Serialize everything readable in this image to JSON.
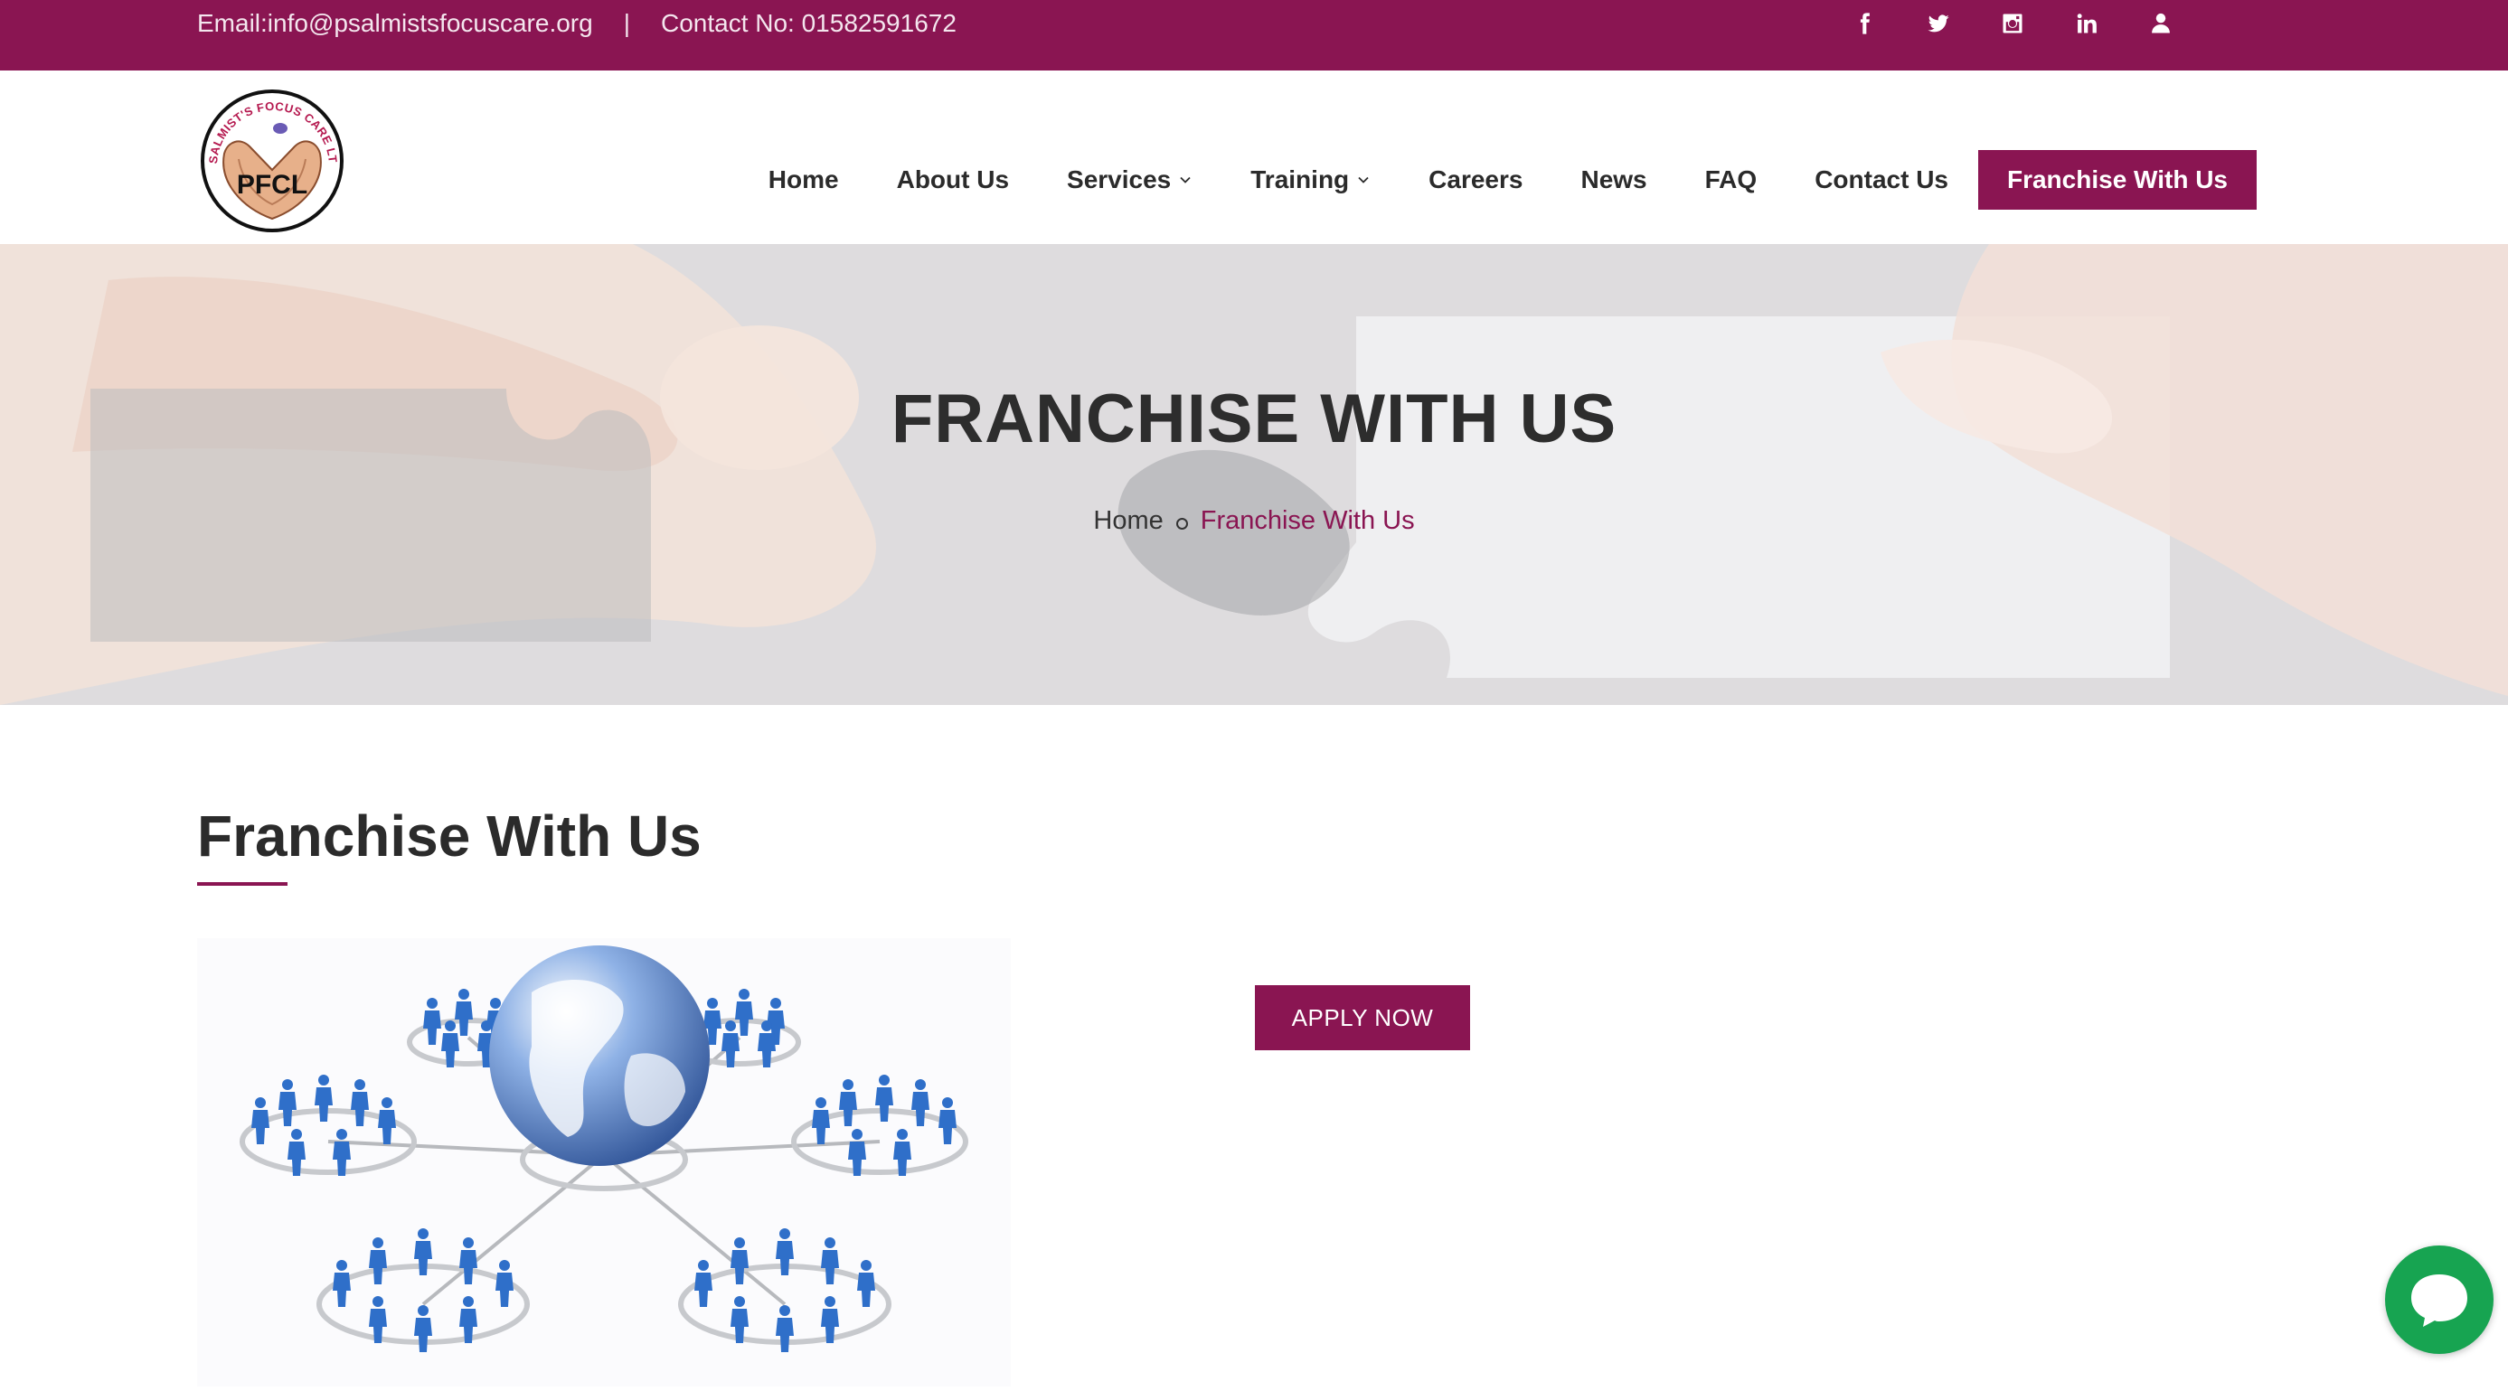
{
  "colors": {
    "brand": "#8a1552",
    "chat": "#17a451"
  },
  "topbar": {
    "email": "Email:info@psalmistsfocuscare.org",
    "separator": "|",
    "contact": "Contact No: 01582591672",
    "social_icons": [
      "facebook-icon",
      "twitter-icon",
      "instagram-icon",
      "linkedin-icon",
      "user-icon"
    ]
  },
  "logo": {
    "arc_text": "PSALMIST'S FOCUS CARE LTD",
    "initials": "PFCL"
  },
  "nav": {
    "home": "Home",
    "about": "About Us",
    "services": "Services",
    "training": "Training",
    "careers": "Careers",
    "news": "News",
    "faq": "FAQ",
    "contact": "Contact Us",
    "franchise": "Franchise With Us"
  },
  "hero": {
    "title": "FRANCHISE WITH US",
    "breadcrumb_home": "Home",
    "breadcrumb_current": "Franchise With Us"
  },
  "main": {
    "heading": "Franchise With Us",
    "apply_label": "APPLY NOW"
  }
}
